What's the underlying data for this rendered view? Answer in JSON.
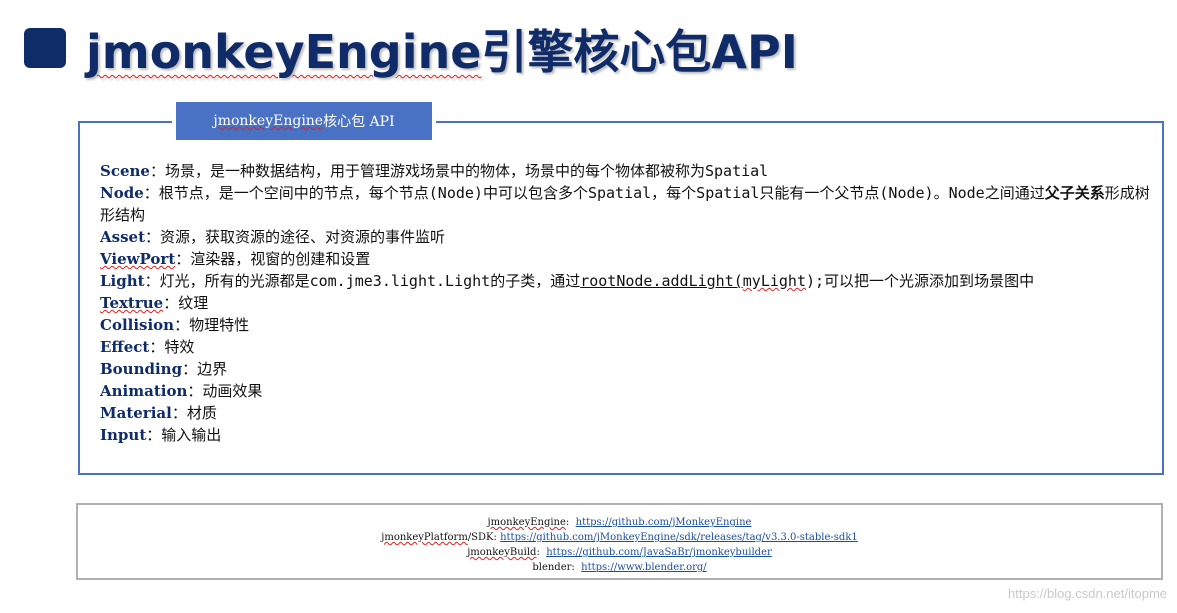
{
  "slide": {
    "title": "jmonkeyEngine引擎核心包API",
    "title_misspelled": "jmonkeyEngine",
    "title_rest": "引擎核心包API"
  },
  "box": {
    "tab_label_sq": "jmonkeyEngine",
    "tab_label_rest": "核心包 API",
    "items": [
      {
        "term": "Scene",
        "sep": "：",
        "desc": "场景，是一种数据结构，用于管理游戏场景中的物体，场景中的每个物体都被称为Spatial"
      },
      {
        "term": "Node",
        "sep": "：",
        "desc": "根节点，是一个空间中的节点，每个节点(Node)中可以包含多个Spatial，每个Spatial只能有一个父节点(Node)。Node之间通过",
        "emph": "父子关系",
        "desc2": "形成树形结构"
      },
      {
        "term": "Asset",
        "sep": "：",
        "desc": "资源，获取资源的途径、对资源的事件监听"
      },
      {
        "term": "ViewPort",
        "sep": "：",
        "desc": "渲染器，视窗的创建和设置"
      },
      {
        "term": "Light",
        "sep": "：",
        "desc": "灯光，所有的光源都是com.jme3.light.Light的子类，通过",
        "code": "rootNode.addLight(",
        "code_sq": "myLight",
        "desc2": ");可以把一个光源添加到场景图中"
      },
      {
        "term": "Textrue",
        "sep": "：",
        "desc": "纹理"
      },
      {
        "term": "Collision",
        "sep": "：",
        "desc": "物理特性"
      },
      {
        "term": "Effect",
        "sep": "：",
        "desc": "特效"
      },
      {
        "term": "Bounding",
        "sep": "：",
        "desc": "边界"
      },
      {
        "term": "Animation",
        "sep": "：",
        "desc": "动画效果"
      },
      {
        "term": "Material",
        "sep": "：",
        "desc": "材质"
      },
      {
        "term": "Input",
        "sep": "：",
        "desc": "输入输出"
      }
    ]
  },
  "links": [
    {
      "label": "jmonkeyEngine",
      "sep": ":  ",
      "url": "https://github.com/jMonkeyEngine"
    },
    {
      "label": "jmonkeyPlatform",
      "label2": "/SDK",
      "sep": ": ",
      "url": "https://github.com/jMonkeyEngine/sdk/releases/tag/v3.3.0-stable-sdk1"
    },
    {
      "label": "jmonkeyBuild",
      "sep": ":  ",
      "url": "https://github.com/JavaSaBr/jmonkeybuilder"
    },
    {
      "label": "blender",
      "sep": ":  ",
      "url": "https://www.blender.org/"
    }
  ],
  "watermark": "https://blog.csdn.net/itopme",
  "colors": {
    "accent": "#0f2b68",
    "box_border": "#4a72c4",
    "tab_bg": "#4a72c4",
    "link": "#1a4fa0"
  }
}
